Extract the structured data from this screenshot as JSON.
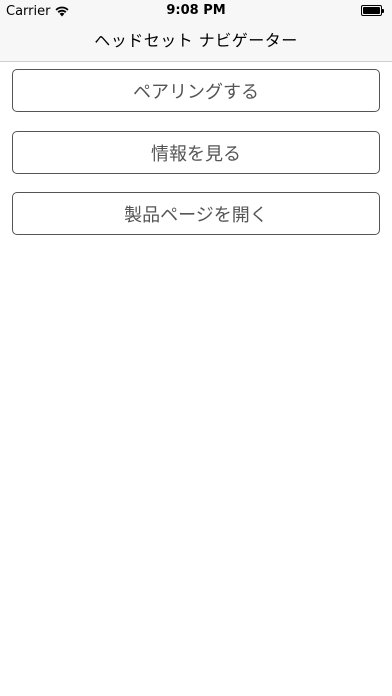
{
  "status_bar": {
    "carrier": "Carrier",
    "time": "9:08 PM",
    "wifi_icon": "wifi-icon",
    "battery_icon": "battery-icon"
  },
  "nav_bar": {
    "title": "ヘッドセット ナビゲーター"
  },
  "buttons": [
    {
      "label": "ペアリングする"
    },
    {
      "label": "情報を見る"
    },
    {
      "label": "製品ページを開く"
    }
  ],
  "colors": {
    "bar_background": "#f7f7f7",
    "button_border": "#555555",
    "button_text": "#555555",
    "background": "#ffffff"
  }
}
